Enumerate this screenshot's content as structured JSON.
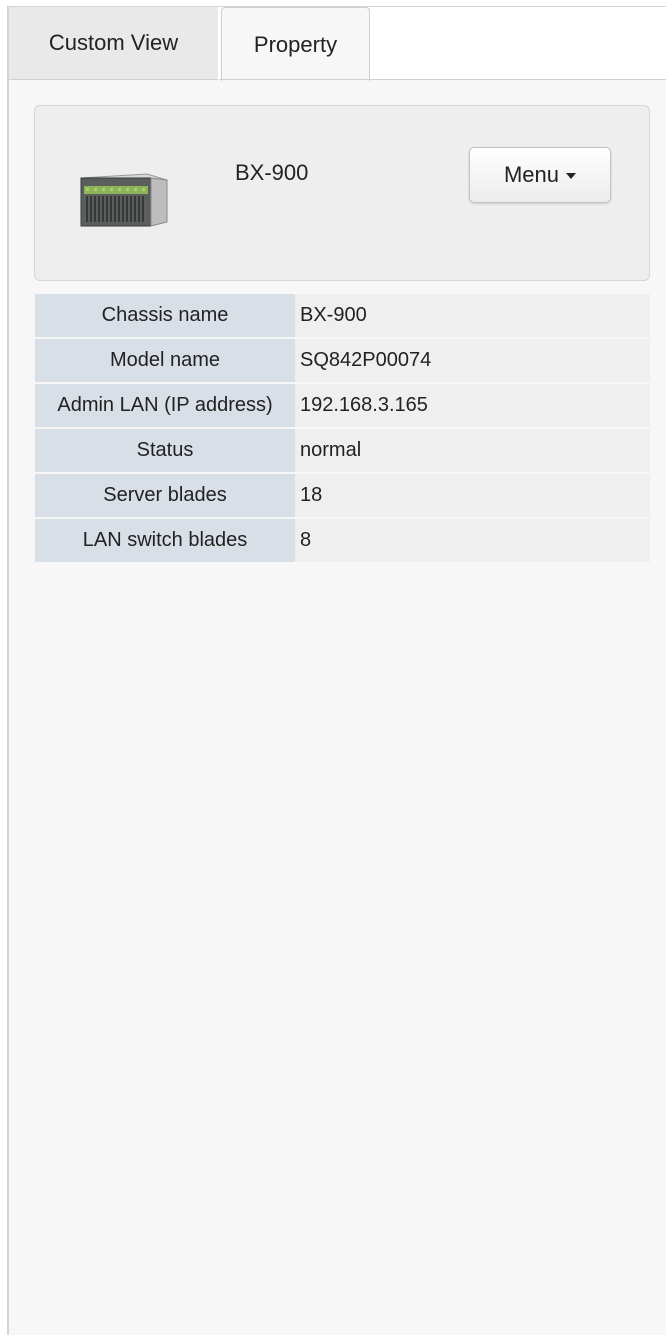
{
  "tabs": [
    {
      "label": "Custom View",
      "active": false
    },
    {
      "label": "Property",
      "active": true
    }
  ],
  "device": {
    "icon": "blade-chassis-icon",
    "name": "BX-900",
    "menu_label": "Menu"
  },
  "properties": [
    {
      "key": "Chassis name",
      "value": "BX-900"
    },
    {
      "key": "Model name",
      "value": "SQ842P00074"
    },
    {
      "key": "Admin LAN (IP address)",
      "value": "192.168.3.165"
    },
    {
      "key": "Status",
      "value": "normal"
    },
    {
      "key": "Server blades",
      "value": "18"
    },
    {
      "key": "LAN switch blades",
      "value": "8"
    }
  ],
  "colors": {
    "label_cell": "#d9dfe6",
    "value_cell": "#efefef",
    "panel_bg": "#f7f7f7",
    "inactive_tab": "#e9e9e9"
  }
}
